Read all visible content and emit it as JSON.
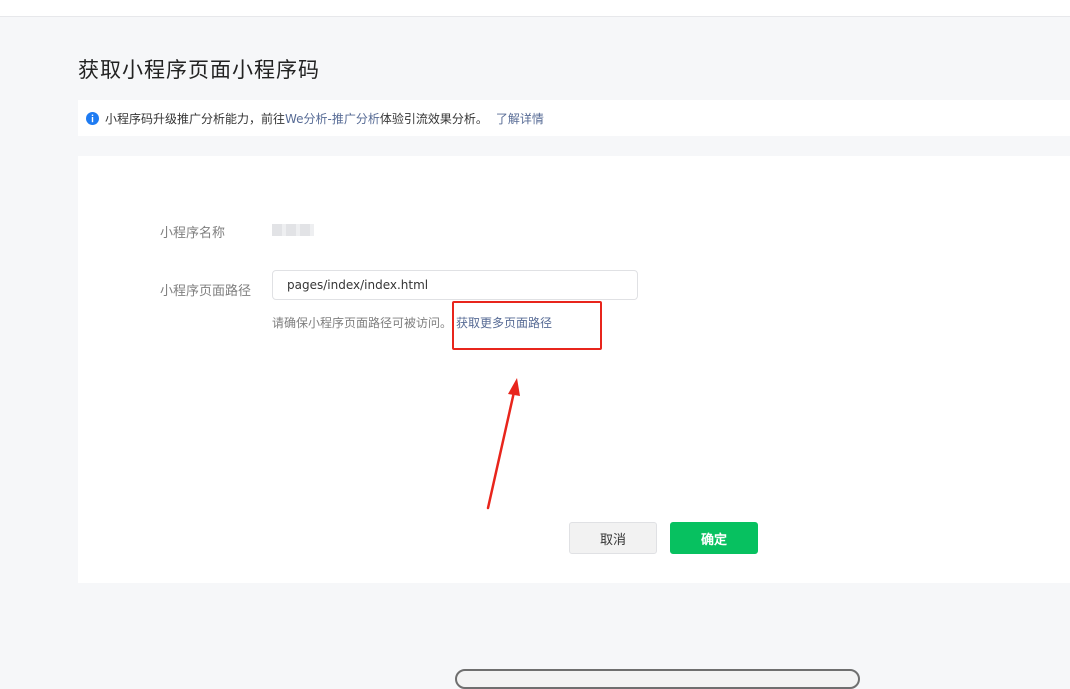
{
  "page": {
    "title": "获取小程序页面小程序码"
  },
  "notice": {
    "text_before": "小程序码升级推广分析能力，前往",
    "link_text": "We分析-推广分析",
    "text_after": "体验引流效果分析。",
    "learn_more": "了解详情",
    "icon": "info-icon"
  },
  "form": {
    "name_label": "小程序名称",
    "path_label": "小程序页面路径",
    "path_value": "pages/index/index.html",
    "hint_text": "请确保小程序页面路径可被访问。",
    "hint_link": "获取更多页面路径"
  },
  "buttons": {
    "cancel": "取消",
    "confirm": "确定"
  },
  "colors": {
    "accent_green": "#07c160",
    "link_blue": "#576b95",
    "info_blue": "#1e7bf2",
    "annotation_red": "#e8251c"
  }
}
